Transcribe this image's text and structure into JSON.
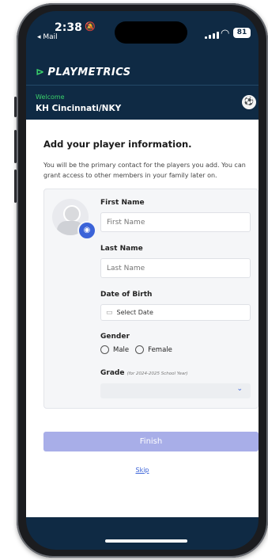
{
  "status_bar": {
    "time": "2:38",
    "back_app": "◂ Mail",
    "battery": "81"
  },
  "header": {
    "brand": "PLAYMETRICS",
    "welcome": "Welcome",
    "club": "KH Cincinnati/NKY"
  },
  "form": {
    "title": "Add your player information.",
    "description": "You will be the primary contact for the players you add. You can grant access to other members in your family later on.",
    "first_name_label": "First Name",
    "first_name_placeholder": "First Name",
    "last_name_label": "Last Name",
    "last_name_placeholder": "Last Name",
    "dob_label": "Date of Birth",
    "dob_placeholder": "Select Date",
    "gender_label": "Gender",
    "gender_options": [
      "Male",
      "Female"
    ],
    "grade_label": "Grade",
    "grade_hint": "(for 2024-2025 School Year)",
    "grade_value": ""
  },
  "actions": {
    "finish": "Finish",
    "skip": "Skip"
  },
  "colors": {
    "header_bg": "#0f2a44",
    "brand_green": "#3ad16b",
    "accent_blue": "#3b63d8",
    "finish_disabled": "#a8aee8"
  }
}
